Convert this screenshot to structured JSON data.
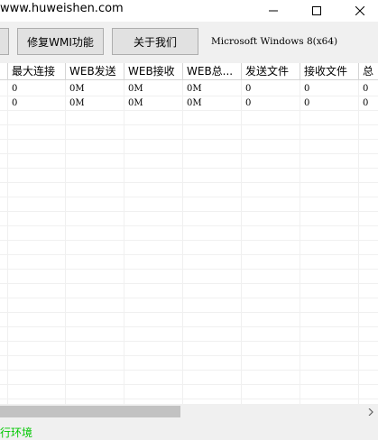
{
  "window": {
    "title": "www.huweishen.com"
  },
  "toolbar": {
    "repair_wmi_label": "修复WMI功能",
    "about_label": "关于我们",
    "os_info": "Microsoft Windows 8(x64)"
  },
  "table": {
    "columns": [
      "最大连接",
      "WEB发送",
      "WEB接收",
      "WEB总...",
      "发送文件",
      "接收文件",
      "总"
    ],
    "rows": [
      [
        "0",
        "0M",
        "0M",
        "0M",
        "0",
        "0",
        "0"
      ],
      [
        "0",
        "0M",
        "0M",
        "0M",
        "0",
        "0",
        "0"
      ]
    ]
  },
  "status": {
    "text": "行环境"
  }
}
